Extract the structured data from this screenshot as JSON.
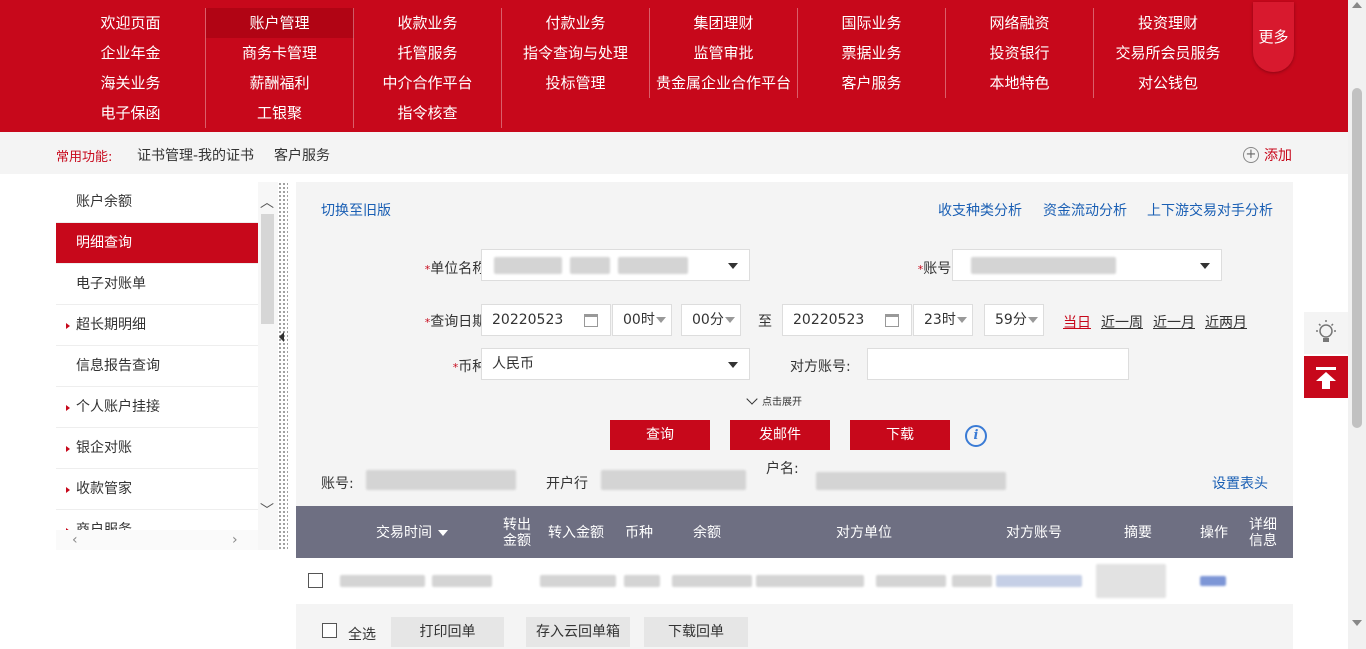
{
  "top_menu": {
    "rows": [
      [
        "欢迎页面",
        "账户管理",
        "收款业务",
        "付款业务",
        "集团理财",
        "国际业务",
        "网络融资",
        "投资理财"
      ],
      [
        "企业年金",
        "商务卡管理",
        "托管服务",
        "指令查询与处理",
        "监管审批",
        "票据业务",
        "投资银行",
        "交易所会员服务"
      ],
      [
        "海关业务",
        "薪酬福利",
        "中介合作平台",
        "投标管理",
        "贵金属企业合作平台",
        "客户服务",
        "本地特色",
        "对公钱包"
      ],
      [
        "电子保函",
        "工银聚",
        "指令核查"
      ]
    ],
    "active": "账户管理",
    "more": "更多"
  },
  "common_bar": {
    "label": "常用功能:",
    "items": [
      "证书管理-我的证书",
      "客户服务"
    ],
    "add": "添加"
  },
  "sidebar": {
    "items": [
      {
        "label": "账户余额",
        "sub": false
      },
      {
        "label": "明细查询",
        "sub": false,
        "active": true
      },
      {
        "label": "电子对账单",
        "sub": false
      },
      {
        "label": "超长期明细",
        "sub": true
      },
      {
        "label": "信息报告查询",
        "sub": false
      },
      {
        "label": "个人账户挂接",
        "sub": true
      },
      {
        "label": "银企对账",
        "sub": true
      },
      {
        "label": "收款管家",
        "sub": true
      },
      {
        "label": "商户服务",
        "sub": true
      }
    ]
  },
  "main": {
    "switch_old": "切换至旧版",
    "analysis_links": [
      "收支种类分析",
      "资金流动分析",
      "上下游交易对手分析"
    ],
    "unit_name_label": "单位名称:",
    "account_label": "账号:",
    "date_label": "查询日期:",
    "start_date": "20220523",
    "start_hour": "00时",
    "start_min": "00分",
    "to": "至",
    "end_date": "20220523",
    "end_hour": "23时",
    "end_min": "59分",
    "quick_dates": [
      "当日",
      "近一周",
      "近一月",
      "近两月"
    ],
    "currency_label": "币种:",
    "currency_value": "人民币",
    "counter_account_label": "对方账号:",
    "expand": "点击展开",
    "buttons": {
      "query": "查询",
      "email": "发邮件",
      "download": "下载"
    },
    "acct_label": "账号:",
    "bank_label": "开户行",
    "name_label": "户名:",
    "set_header": "设置表头"
  },
  "table": {
    "headers": [
      "交易时间",
      "转出\n金额",
      "转入金额",
      "币种",
      "余额",
      "对方单位",
      "对方账号",
      "摘要",
      "操作",
      "详细\n信息"
    ]
  },
  "footer": {
    "select_all": "全选",
    "buttons": [
      "打印回单",
      "存入云回单箱",
      "下载回单"
    ]
  },
  "colors": {
    "brand": "#c7081b",
    "table_header": "#6e6f82",
    "link": "#1a5fb4"
  }
}
